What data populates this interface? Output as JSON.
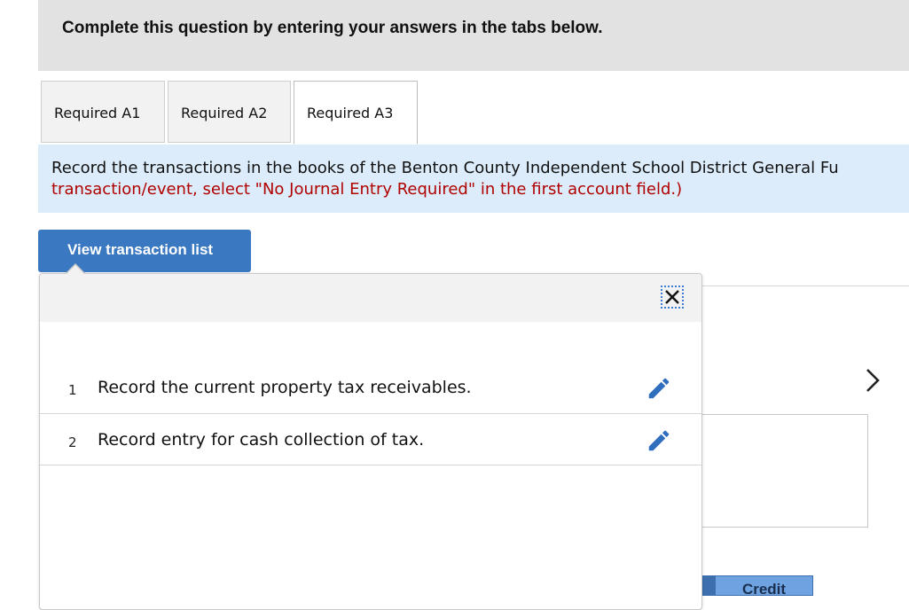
{
  "header": {
    "instruction": "Complete this question by entering your answers in the tabs below."
  },
  "tabs": [
    {
      "label": "Required A1",
      "active": false
    },
    {
      "label": "Required A2",
      "active": false
    },
    {
      "label": "Required A3",
      "active": true
    }
  ],
  "instructions": {
    "line1": "Record the transactions in the books of the Benton County Independent School District General Fu",
    "line2": "transaction/event, select \"No Journal Entry Required\" in the first account field.)"
  },
  "view_transactions_label": "View transaction list",
  "transactions": [
    {
      "number": "1",
      "description": "Record the current property tax receivables."
    },
    {
      "number": "2",
      "description": "Record entry for cash collection of tax."
    }
  ],
  "journal": {
    "credit_header": "Credit"
  },
  "icons": {
    "close": "close-icon",
    "edit": "pencil-icon",
    "next": "chevron-right-icon"
  },
  "colors": {
    "accent": "#3a78c2",
    "instruction_bg": "#dcecfa",
    "warning_text": "#b00000",
    "header_bg": "#e2e2e2"
  }
}
